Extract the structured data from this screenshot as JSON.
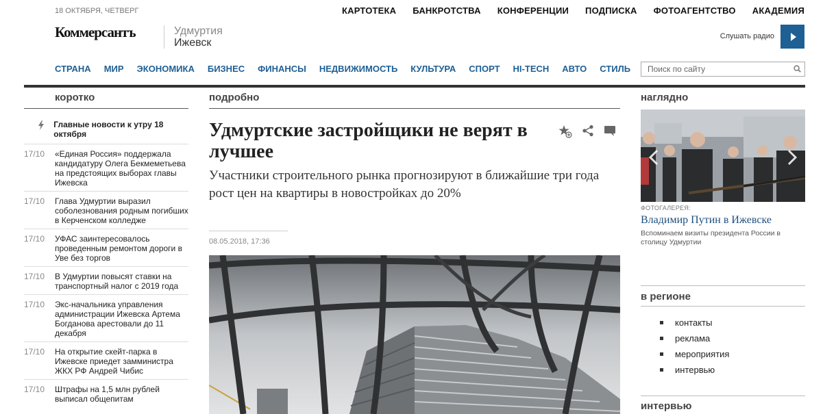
{
  "header": {
    "date": "18 ОКТЯБРЯ, ЧЕТВЕРГ",
    "top_links": [
      "КАРТОТЕКА",
      "БАНКРОТСТВА",
      "КОНФЕРЕНЦИИ",
      "ПОДПИСКА",
      "ФОТОАГЕНТСТВО",
      "АКАДЕМИЯ"
    ],
    "logo": "Коммерсантъ",
    "region_line1": "Удмуртия",
    "region_line2": "Ижевск",
    "radio_label": "Слушать радио",
    "nav": [
      "СТРАНА",
      "МИР",
      "ЭКОНОМИКА",
      "БИЗНЕС",
      "ФИНАНСЫ",
      "НЕДВИЖИМОСТЬ",
      "КУЛЬТУРА",
      "СПОРТ",
      "HI-TECH",
      "АВТО",
      "СТИЛЬ"
    ],
    "search_placeholder": "Поиск по сайту"
  },
  "left": {
    "heading": "коротко",
    "top_item": "Главные новости к утру 18 октября",
    "items": [
      {
        "date": "17/10",
        "text": "«Единая Россия» поддержала кандидатуру Олега Бекмеметьева на предстоящих выборах главы Ижевска"
      },
      {
        "date": "17/10",
        "text": "Глава Удмуртии выразил соболезнования родным погибших в Керченском колледже"
      },
      {
        "date": "17/10",
        "text": "УФАС заинтересовалось проведенным ремонтом дороги в Уве без торгов"
      },
      {
        "date": "17/10",
        "text": "В Удмуртии повысят ставки на транспортный налог с 2019 года"
      },
      {
        "date": "17/10",
        "text": "Экс-начальника управления администрации Ижевска Артема Богданова арестовали до 11 декабря"
      },
      {
        "date": "17/10",
        "text": "На открытие скейт-парка в Ижевске приедет замминистра ЖКХ РФ Андрей Чибис"
      },
      {
        "date": "17/10",
        "text": "Штрафы на 1,5 млн рублей выписал общепитам"
      }
    ]
  },
  "center": {
    "heading": "подробно",
    "headline": "Удмуртские застройщики не верят в лучшее",
    "subhead": "Участники строительного рынка прогнозируют в ближайшие три года рост цен на квартиры в новостройках до 20%",
    "pubdate": "08.05.2018, 17:36"
  },
  "right": {
    "heading": "наглядно",
    "gallery_label": "ФОТОГАЛЕРЕЯ:",
    "gallery_title": "Владимир Путин в Ижевске",
    "gallery_desc": "Вспоминаем визиты президента России в столицу Удмуртии",
    "region_heading": "в регионе",
    "region_links": [
      "контакты",
      "реклама",
      "мероприятия",
      "интервью"
    ],
    "interview_heading": "интервью"
  },
  "colors": {
    "accent": "#1e5f94",
    "rule": "#333333"
  }
}
